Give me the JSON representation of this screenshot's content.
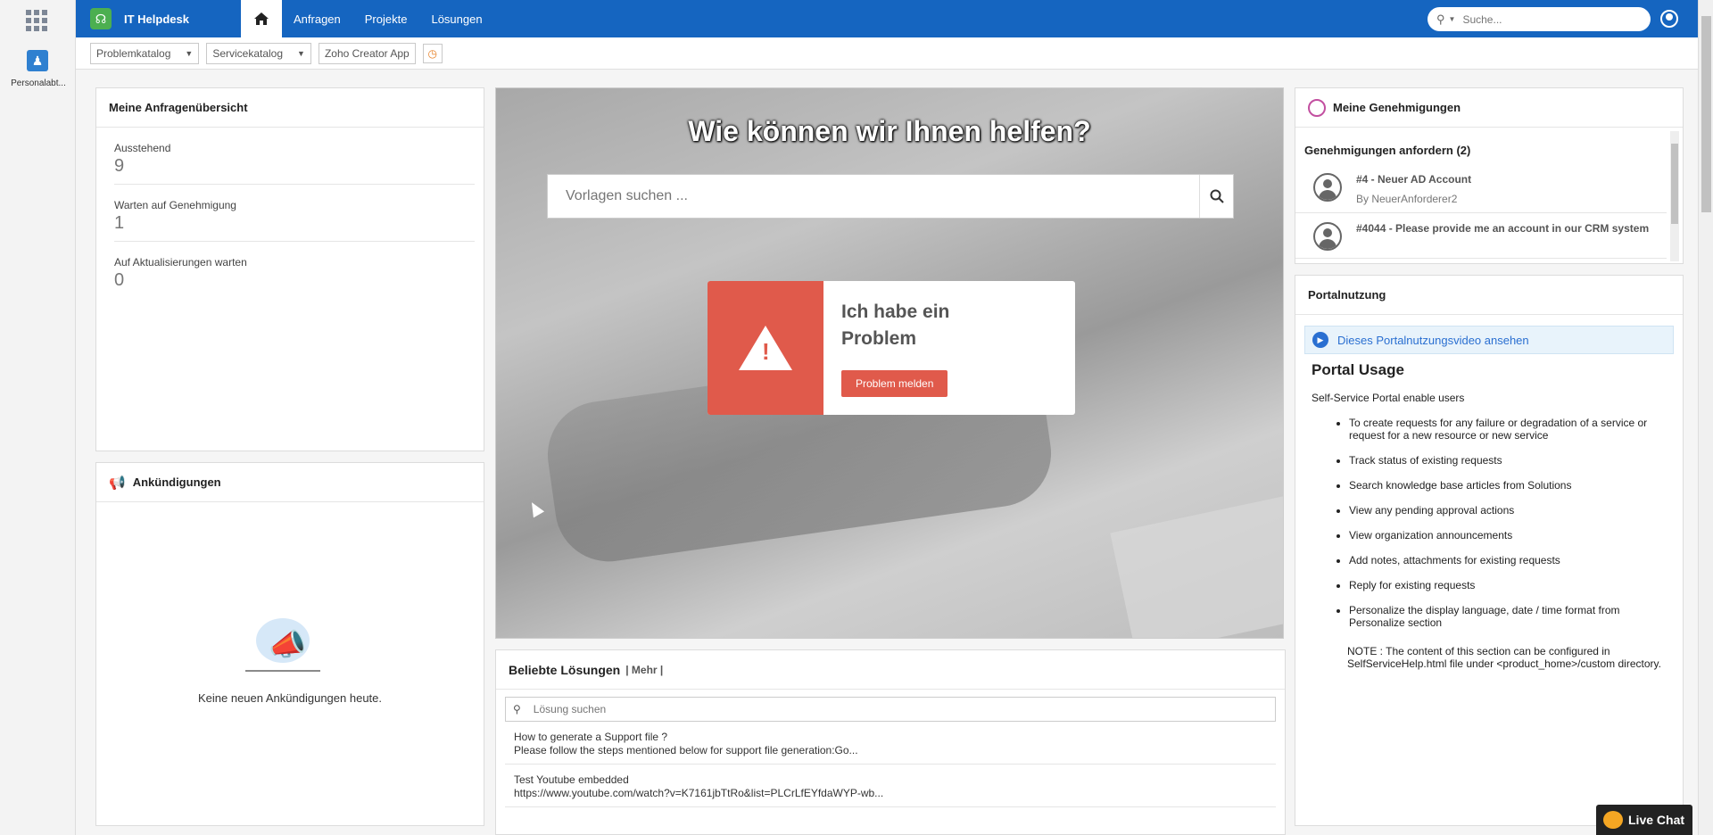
{
  "rail": {
    "app_label": "Personalabt..."
  },
  "header": {
    "title": "IT Helpdesk",
    "nav": [
      "Anfragen",
      "Projekte",
      "Lösungen"
    ],
    "search_placeholder": "Suche...",
    "brand_color": "#1565c0"
  },
  "toolbar": {
    "problem_catalog": "Problemkatalog",
    "service_catalog": "Servicekatalog",
    "zoho_app": "Zoho Creator App"
  },
  "overview": {
    "title": "Meine Anfragenübersicht",
    "items": [
      {
        "label": "Ausstehend",
        "value": "9"
      },
      {
        "label": "Warten auf Genehmigung",
        "value": "1"
      },
      {
        "label": "Auf Aktualisierungen warten",
        "value": "0"
      }
    ]
  },
  "announcements": {
    "title": "Ankündigungen",
    "empty_text": "Keine neuen Ankündigungen heute."
  },
  "hero": {
    "title": "Wie können wir Ihnen helfen?",
    "search_placeholder": "Vorlagen suchen ...",
    "problem_title": "Ich habe ein Problem",
    "problem_button": "Problem melden",
    "accent_color": "#e05a4b"
  },
  "solutions": {
    "title": "Beliebte Lösungen",
    "more": "| Mehr |",
    "search_placeholder": "Lösung suchen",
    "items": [
      {
        "title": "How to generate a Support file ?",
        "snippet": "Please follow the steps mentioned below for support file generation:Go..."
      },
      {
        "title": "Test Youtube embedded",
        "snippet": "https://www.youtube.com/watch?v=K7161jbTtRo&list=PLCrLfEYfdaWYP-wb..."
      }
    ]
  },
  "approvals": {
    "title": "Meine Genehmigungen",
    "subtitle": "Genehmigungen anfordern (2)",
    "items": [
      {
        "title": "#4 - Neuer AD Account",
        "by": "By NeuerAnforderer2"
      },
      {
        "title": "#4044 - Please provide me an account in our CRM system",
        "by": ""
      }
    ]
  },
  "usage": {
    "title": "Portalnutzung",
    "video_link": "Dieses Portalnutzungsvideo ansehen",
    "heading": "Portal Usage",
    "intro": "Self-Service Portal enable users",
    "bullets": [
      "To create requests for any failure or degradation of a service or request for a new resource or new service",
      "Track status of existing requests",
      "Search knowledge base articles from Solutions",
      "View any pending approval actions",
      "View organization announcements",
      "Add notes, attachments for existing requests",
      "Reply for existing requests",
      "Personalize the display language, date / time format from Personalize section"
    ],
    "note": "NOTE : The content of this section can be configured in SelfServiceHelp.html file under <product_home>/custom directory."
  },
  "live_chat": {
    "label": "Live Chat"
  }
}
